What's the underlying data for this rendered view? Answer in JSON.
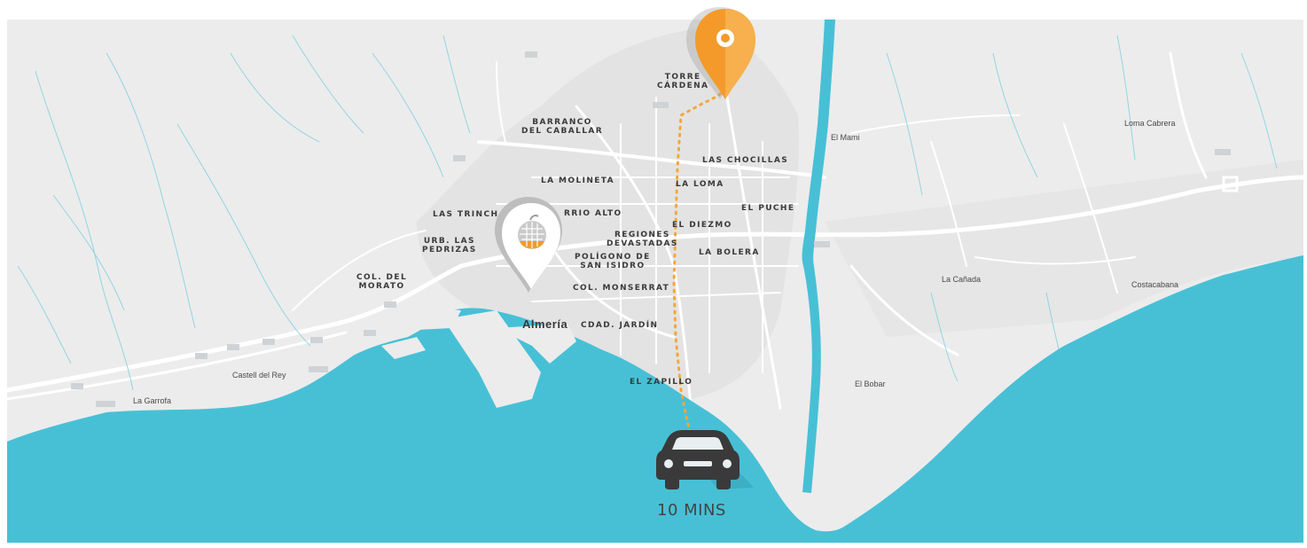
{
  "colors": {
    "land": "#ececec",
    "sea": "#47c0d6",
    "river": "#47c0d6",
    "road": "#ffffff",
    "route": "#f3a73b",
    "pin_orange": "#f39a2a",
    "pin_grey": "#d3d3d3",
    "car": "#3a3a3a"
  },
  "labels": {
    "torrecardenas": "TORRE\nCÁRDENA",
    "barranco": "BARRANCO\nDEL CABALLAR",
    "las_chocillas": "LAS CHOCILLAS",
    "la_molineta": "LA MOLINETA",
    "la_loma": "LA LOMA",
    "las_trinch": "LAS TRINCH",
    "barrio_alto": "RRIO ALTO",
    "el_puche": "EL PUCHE",
    "el_diezmo": "EL DIEZMO",
    "regiones": "REGIONES\nDEVASTADAS",
    "urb_pedrizas": "URB. LAS\nPEDRIZAS",
    "poligono": "POLÍGONO DE\nSAN ISIDRO",
    "la_bolera": "LA BOLERA",
    "col_morato": "COL. DEL\nMORATO",
    "col_monserrat": "COL. MONSERRAT",
    "almeria": "Almería",
    "cdad_jardin": "CDAD. JARDÍN",
    "el_zapillo": "EL ZAPILLO",
    "el_mami": "El Mami",
    "loma_cabrera": "Loma Cabrera",
    "la_canada": "La Cañada",
    "costacabana": "Costacabana",
    "el_bobar": "El Bobar",
    "castell_del_rey": "Castell del Rey",
    "la_garrofa": "La Garrofa"
  },
  "travel_time": "10 MINS",
  "icons": {
    "destination_pin": "orange-location-pin-icon",
    "origin_pin": "grey-location-pin-with-logo-icon",
    "car": "car-icon"
  }
}
